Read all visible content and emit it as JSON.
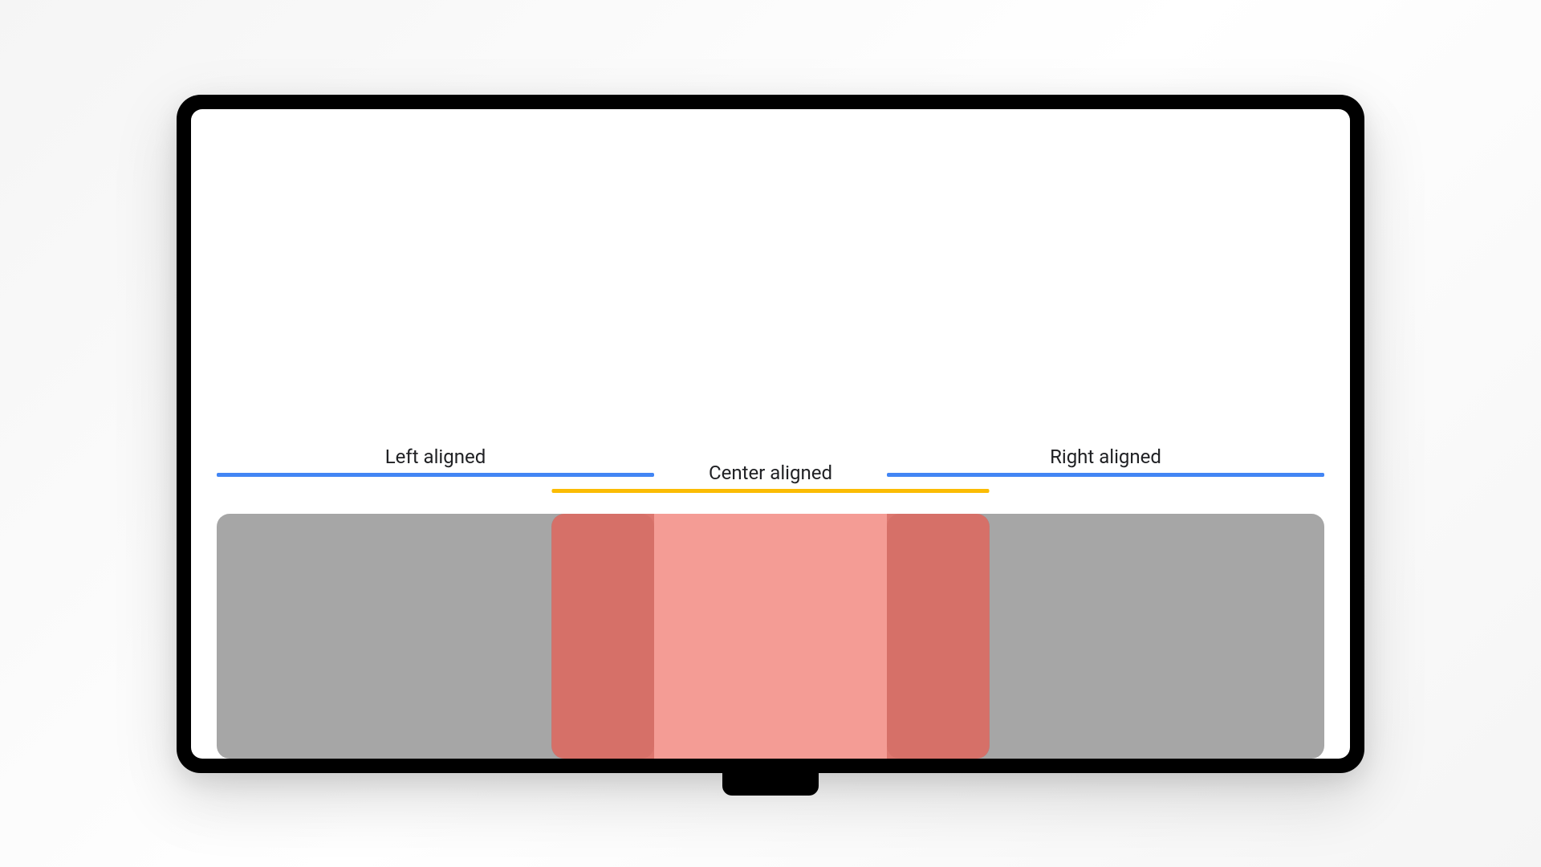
{
  "alignment_diagram": {
    "labels": {
      "left": "Left aligned",
      "center": "Center aligned",
      "right": "Right aligned"
    },
    "colors": {
      "line_side": "#4285f4",
      "line_center": "#fbbc04",
      "card_side": "#a6a6a6",
      "card_center": "#f28b82",
      "overlap": "#c8574f"
    }
  }
}
